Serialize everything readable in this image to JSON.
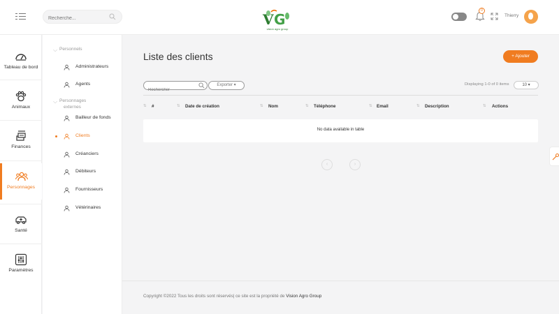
{
  "topbar": {
    "search_placeholder": "Recherche...",
    "logo_text": "vision agro group",
    "notification_count": "0",
    "username": "Thierry"
  },
  "sidebar": {
    "items": [
      {
        "label": "Tableau de bord",
        "icon": "dashboard-icon",
        "active": false
      },
      {
        "label": "Animaux",
        "icon": "paw-icon",
        "active": false
      },
      {
        "label": "Finances",
        "icon": "money-icon",
        "active": false
      },
      {
        "label": "Personnages",
        "icon": "people-icon",
        "active": true
      },
      {
        "label": "Santé",
        "icon": "health-icon",
        "active": false
      },
      {
        "label": "Paramètres",
        "icon": "settings-icon",
        "active": false
      }
    ]
  },
  "submenu": {
    "group1": "Personnels",
    "group1_items": [
      "Administrateurs",
      "Agents"
    ],
    "group2_line1": "Personnages",
    "group2_line2": "externes",
    "group2_items": [
      "Bailleur de fonds",
      "Clients",
      "Créanciers",
      "Débiteurs",
      "Fournisseurs",
      "Vétérinaires"
    ],
    "active_item": "Clients"
  },
  "main": {
    "title": "Liste des clients",
    "add_button": "+ Ajouter",
    "search_placeholder": "Rechercher",
    "export_label": "Exporter ▾",
    "displaying": "Displaying 1-0 of 0 items",
    "per_page": "10 ▾",
    "columns": [
      "#",
      "Date de création",
      "Nom",
      "Téléphone",
      "Email",
      "Description",
      "Actions"
    ],
    "empty_message": "No data available in table",
    "pagination_prev": "‹",
    "pagination_next": "›"
  },
  "footer": {
    "text": "Copyright ©2022 Tous les droits sont réservés| ce site est la propriété de ",
    "company": "Vision Agro Group"
  },
  "colors": {
    "accent": "#f07c20",
    "logo_green": "#2e7d32"
  }
}
